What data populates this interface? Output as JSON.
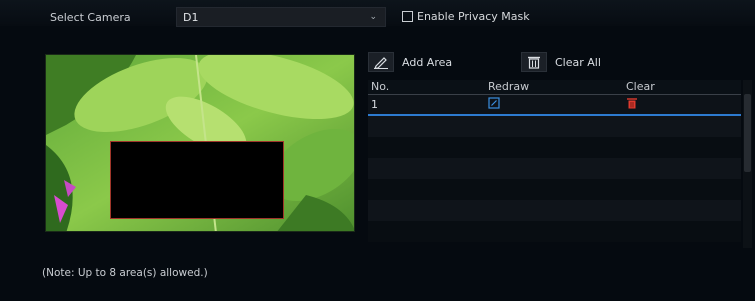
{
  "camera": {
    "label": "Select Camera",
    "selected": "D1"
  },
  "privacy_mask": {
    "label": "Enable Privacy Mask",
    "checked": false
  },
  "toolbar": {
    "add_area_label": "Add Area",
    "clear_all_label": "Clear All"
  },
  "table": {
    "headers": [
      "No.",
      "Redraw",
      "Clear"
    ],
    "rows": [
      {
        "no": "1"
      }
    ]
  },
  "note": "(Note: Up to 8 area(s) allowed.)",
  "colors": {
    "selection_line": "#2d7bd0",
    "clear_icon": "#e03a2e",
    "redraw_icon": "#3a8fe0",
    "mask_border": "#a0362a"
  }
}
